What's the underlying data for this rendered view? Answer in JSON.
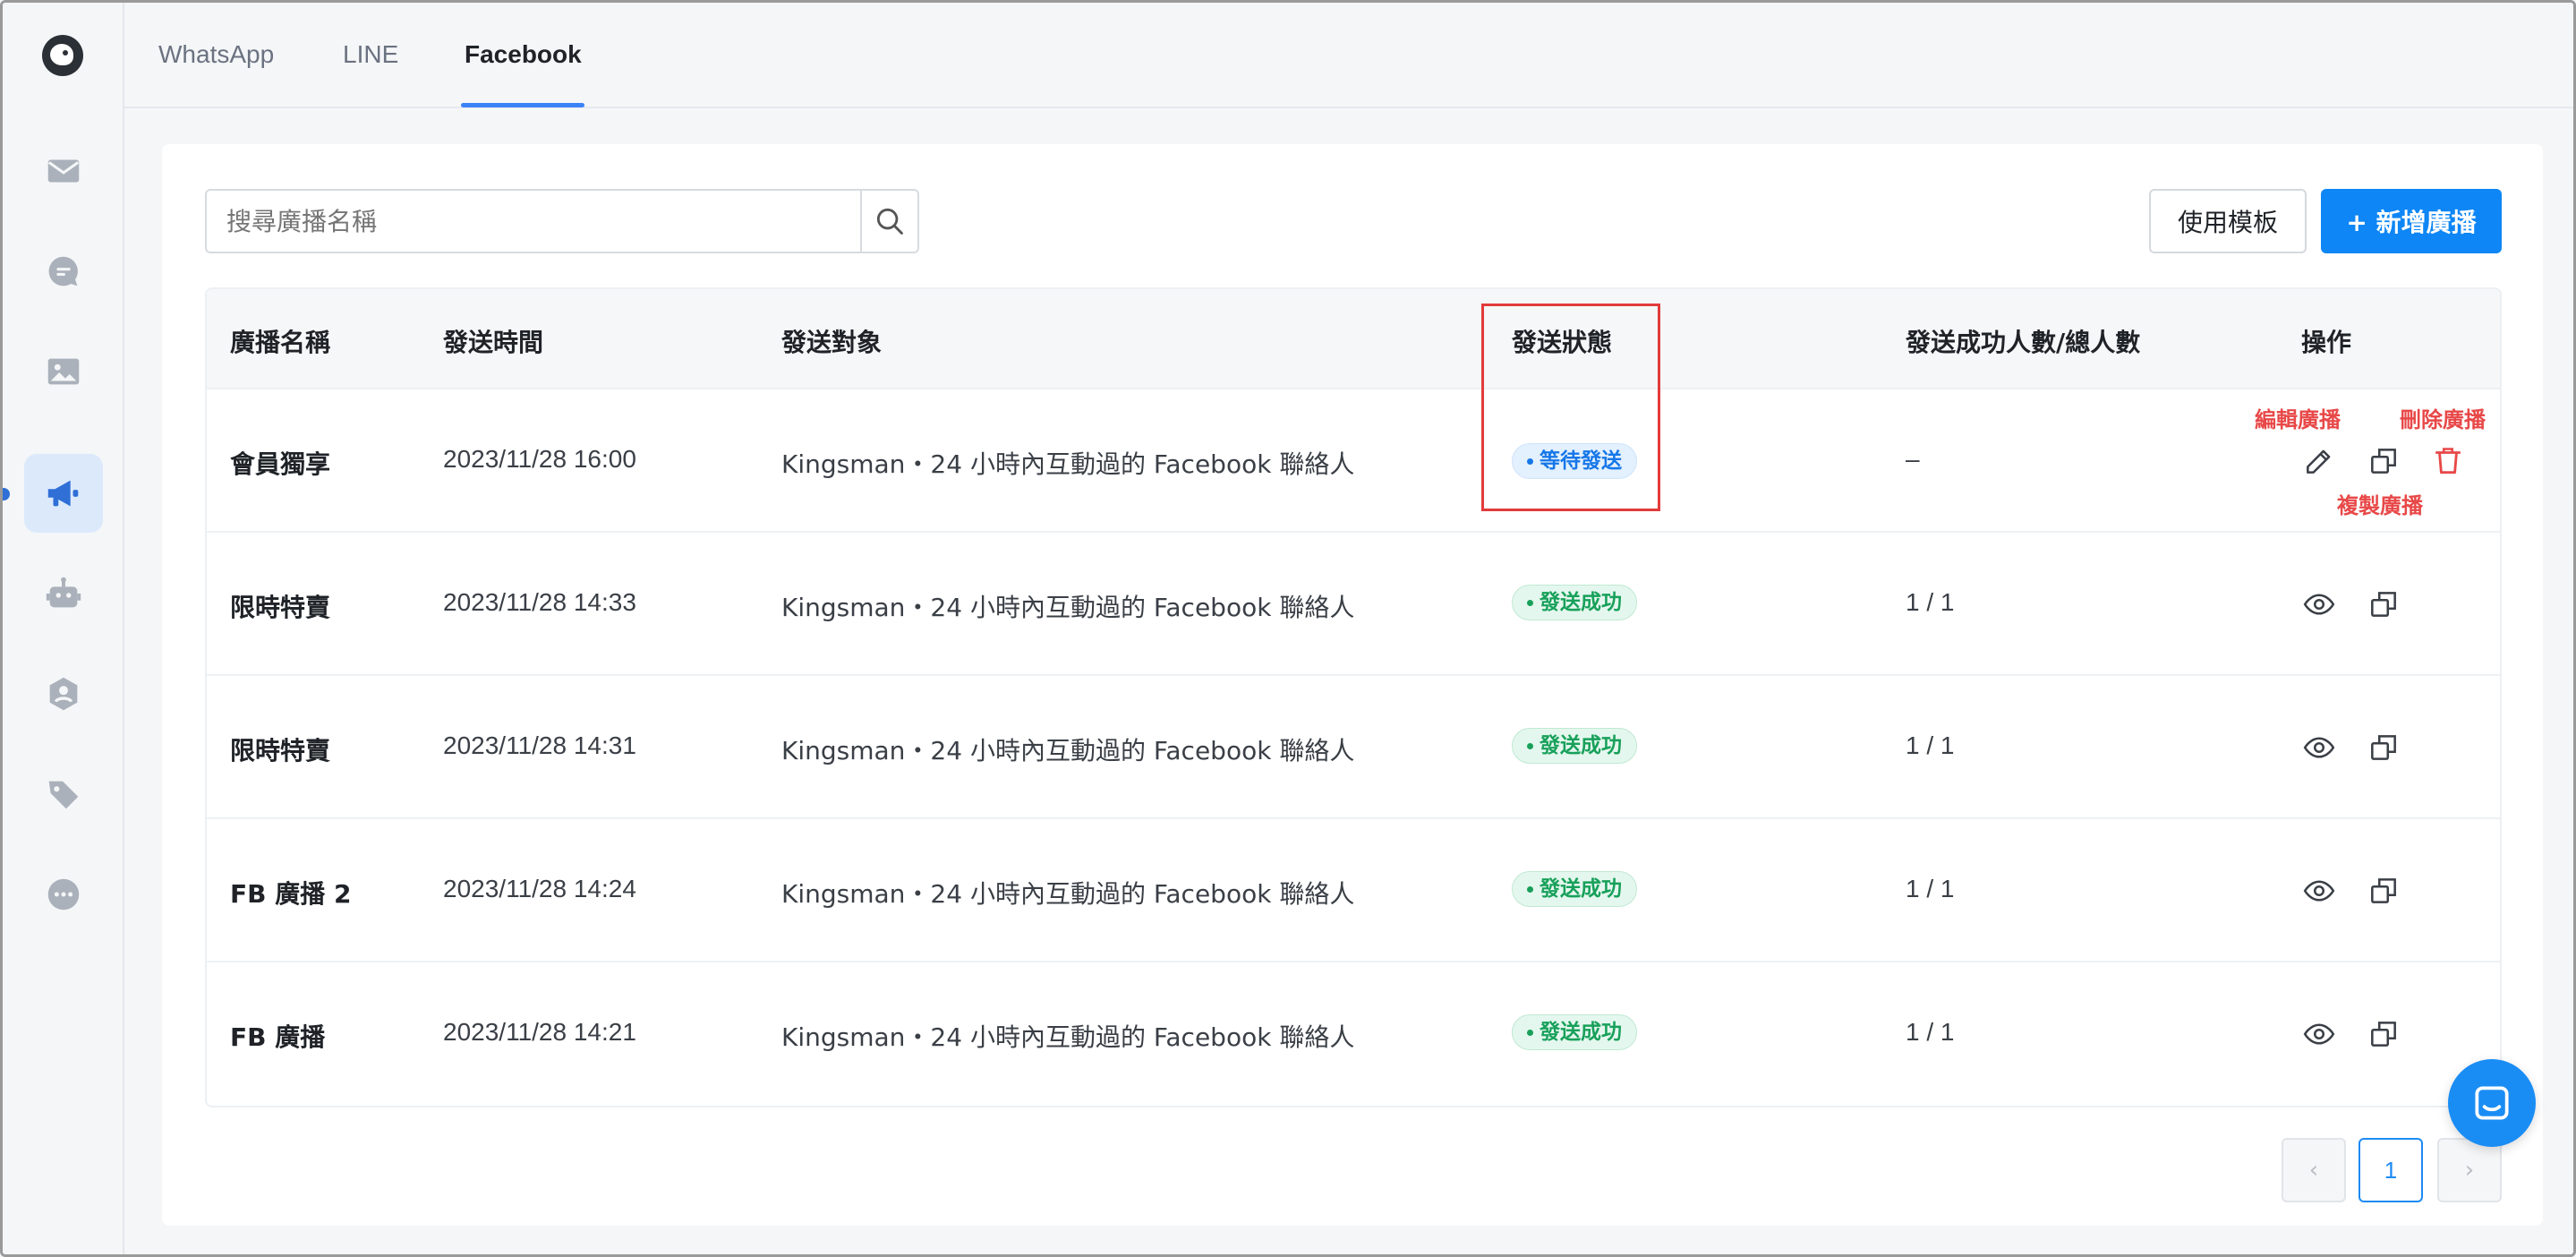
{
  "tabs": [
    {
      "label": "WhatsApp"
    },
    {
      "label": "LINE"
    },
    {
      "label": "Facebook"
    }
  ],
  "active_tab": "Facebook",
  "sidebar": {
    "items": [
      {
        "icon": "mail-icon"
      },
      {
        "icon": "chat-icon"
      },
      {
        "icon": "image-icon"
      },
      {
        "icon": "megaphone-icon"
      },
      {
        "icon": "robot-icon"
      },
      {
        "icon": "contact-icon"
      },
      {
        "icon": "tag-icon"
      },
      {
        "icon": "more-icon"
      }
    ],
    "active_item": "megaphone-icon"
  },
  "search": {
    "placeholder": "搜尋廣播名稱"
  },
  "toolbar": {
    "template_label": "使用模板",
    "add_label": "+ 新增廣播"
  },
  "table": {
    "headers": {
      "name": "廣播名稱",
      "time": "發送時間",
      "target": "發送對象",
      "status": "發送狀態",
      "count": "發送成功人數/總人數",
      "actions": "操作"
    },
    "rows": [
      {
        "name": "會員獨享",
        "time": "2023/11/28 16:00",
        "target": "Kingsman・24 小時內互動過的 Facebook 聯絡人",
        "status": "等待發送",
        "count": "–"
      },
      {
        "name": "限時特賣",
        "time": "2023/11/28 14:33",
        "target": "Kingsman・24 小時內互動過的 Facebook 聯絡人",
        "status": "發送成功",
        "count": "1 / 1"
      },
      {
        "name": "限時特賣",
        "time": "2023/11/28 14:31",
        "target": "Kingsman・24 小時內互動過的 Facebook 聯絡人",
        "status": "發送成功",
        "count": "1 / 1"
      },
      {
        "name": "FB 廣播 2",
        "time": "2023/11/28 14:24",
        "target": "Kingsman・24 小時內互動過的 Facebook 聯絡人",
        "status": "發送成功",
        "count": "1 / 1"
      },
      {
        "name": "FB 廣播",
        "time": "2023/11/28 14:21",
        "target": "Kingsman・24 小時內互動過的 Facebook 聯絡人",
        "status": "發送成功",
        "count": "1 / 1"
      }
    ]
  },
  "annotations": {
    "edit": "編輯廣播",
    "delete": "刪除廣播",
    "copy": "複製廣播"
  },
  "pagination": {
    "prev": "‹",
    "current": "1",
    "next": "›"
  },
  "colors": {
    "accent": "#0e86f5",
    "pending": "#1677e8",
    "success": "#18a05a",
    "annotation": "#e23b3b"
  }
}
